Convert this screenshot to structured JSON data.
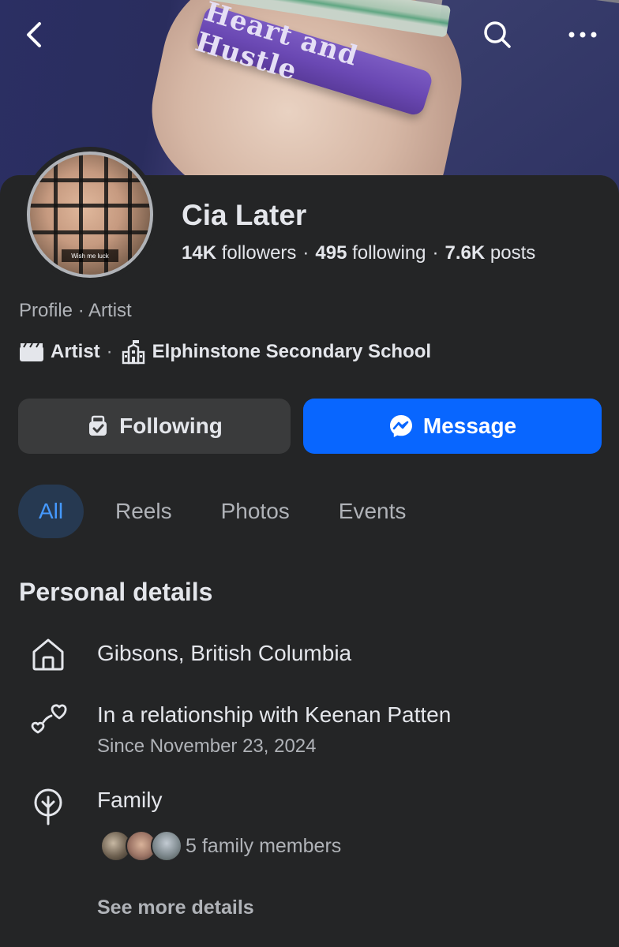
{
  "cover": {
    "wristband_text": "Heart and Hustle"
  },
  "profile": {
    "name": "Cia Later",
    "avatar_caption": "Wish me luck",
    "stats": {
      "followers_value": "14K",
      "followers_label": "followers",
      "following_value": "495",
      "following_label": "following",
      "posts_value": "7.6K",
      "posts_label": "posts"
    },
    "category": "Profile · Artist",
    "tags": {
      "tag1": "Artist",
      "tag2": "Elphinstone Secondary School"
    }
  },
  "actions": {
    "following_label": "Following",
    "message_label": "Message"
  },
  "tabs": [
    {
      "label": "All",
      "active": true
    },
    {
      "label": "Reels"
    },
    {
      "label": "Photos"
    },
    {
      "label": "Events"
    }
  ],
  "personal_details": {
    "title": "Personal details",
    "location": "Gibsons, British Columbia",
    "relationship": "In a relationship with Keenan Patten",
    "relationship_since": "Since November 23, 2024",
    "family_label": "Family",
    "family_count": "5 family members",
    "see_more": "See more details"
  },
  "icons": {
    "back": "chevron-left-icon",
    "search": "search-icon",
    "more": "more-dots-icon",
    "artist": "clapperboard-icon",
    "school": "school-icon",
    "following": "following-icon",
    "message": "messenger-icon",
    "home": "home-icon",
    "relationship": "hearts-icon",
    "family": "family-tree-icon"
  },
  "colors": {
    "background": "#242526",
    "primary_button": "#0866ff",
    "secondary_button": "#3a3b3c",
    "active_tab_bg": "#263951",
    "active_tab_text": "#4599ff",
    "text_primary": "#e4e6eb",
    "text_secondary": "#b0b3b8"
  }
}
